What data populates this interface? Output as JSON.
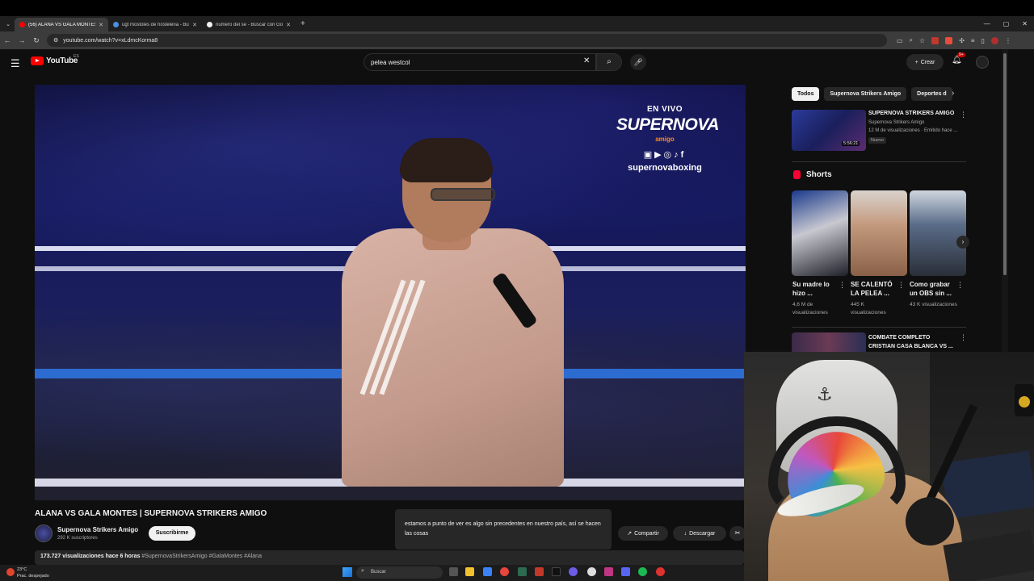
{
  "browser": {
    "tabs": [
      {
        "title": "(56) ALANA VS GALA MONTES",
        "active": true,
        "color": "#ff0000"
      },
      {
        "title": "ugt mostoles de hosteleria - Bu",
        "active": false,
        "color": "#4a90e2"
      },
      {
        "title": "numero del se - Buscar con Go",
        "active": false,
        "color": "#f1f1f1"
      }
    ],
    "url": "youtube.com/watch?v=xLdmcKorma8"
  },
  "youtube": {
    "logo": "YouTube",
    "region": "ES",
    "search_value": "pelea westcol",
    "create_label": "Crear",
    "notif_count": "9+"
  },
  "video": {
    "overlay_live": "EN VIVO",
    "overlay_brand": "SUPERNOVA",
    "overlay_amigo": "amigo",
    "overlay_handle": "supernovaboxing",
    "title": "ALANA VS GALA MONTES | SUPERNOVA STRIKERS AMIGO",
    "channel": "Supernova Strikers Amigo",
    "subscribers": "292 K suscriptores",
    "subscribe_label": "Suscribirme",
    "caption": "estamos a punto de ver es algo sin precedentes en nuestro país, así se hacen las cosas",
    "share_label": "Compartir",
    "download_label": "Descargar",
    "views": "173.727 visualizaciones",
    "age": "hace 6 horas",
    "tags": "#SupernovaStrikersAmigo #GalaMontes #Alana"
  },
  "sidebar": {
    "chips": [
      "Todos",
      "Supernova Strikers Amigo",
      "Deportes d"
    ],
    "rec1": {
      "title": "SUPERNOVA STRIKERS AMIGO",
      "channel": "Supernova Strikers Amigo",
      "meta": "12 M de visualizaciones · Emitido hace ...",
      "badge": "Nuevo",
      "duration": "5:56:21"
    },
    "shorts_label": "Shorts",
    "shorts": [
      {
        "title": "Su madre lo hizo ...",
        "views": "4,6 M de visualizaciones"
      },
      {
        "title": "SE CALENTÓ LA PELEA ...",
        "views": "445 K visualizaciones"
      },
      {
        "title": "Como grabar un OBS sin ...",
        "views": "43 K visualizaciones"
      }
    ],
    "rec2": {
      "title": "COMBATE COMPLETO CRISTIAN CASA BLANCA VS ..."
    }
  },
  "taskbar": {
    "temp": "23°C",
    "weather": "Prac. despejado",
    "search_placeholder": "Buscar"
  }
}
